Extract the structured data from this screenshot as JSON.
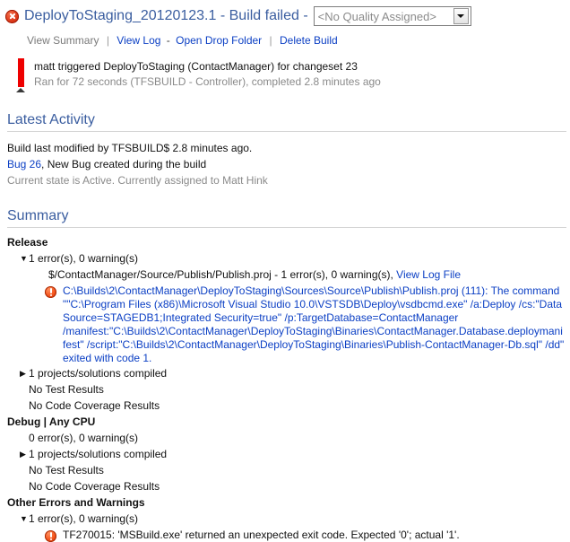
{
  "header": {
    "status_icon": "error-x-icon",
    "title": "DeployToStaging_20120123.1 - Build failed -",
    "quality": {
      "value": "<No Quality Assigned>",
      "dropdown_icon": "chevron-down-icon"
    }
  },
  "links": {
    "view_summary": "View Summary",
    "view_log": "View Log",
    "dash": "-",
    "open_drop_folder": "Open Drop Folder",
    "delete_build": "Delete Build",
    "separator": "|"
  },
  "trigger": {
    "line1": "matt triggered DeployToStaging (ContactManager) for changeset 23",
    "line2": "Ran for 72 seconds (TFSBUILD - Controller), completed 2.8 minutes ago"
  },
  "latest_activity": {
    "title": "Latest Activity",
    "modified": "Build last modified by TFSBUILD$ 2.8 minutes ago.",
    "bug_link": "Bug 26",
    "bug_rest": ", New Bug created during the build",
    "bug_state": "Current state is Active. Currently assigned to Matt Hink"
  },
  "summary": {
    "title": "Summary",
    "configurations": [
      {
        "name": "Release",
        "counts_row": {
          "twisty": "▼",
          "label": "1 error(s), 0 warning(s)"
        },
        "project_row": {
          "text": "$/ContactManager/Source/Publish/Publish.proj - 1 error(s), 0 warning(s), ",
          "link": "View Log File"
        },
        "errors": [
          {
            "icon": "error-exclamation-icon",
            "message": "C:\\Builds\\2\\ContactManager\\DeployToStaging\\Sources\\Source\\Publish\\Publish.proj (111): The command \"\"C:\\Program Files (x86)\\Microsoft Visual Studio 10.0\\VSTSDB\\Deploy\\vsdbcmd.exe\" /a:Deploy /cs:\"Data Source=STAGEDB1;Integrated Security=true\" /p:TargetDatabase=ContactManager /manifest:\"C:\\Builds\\2\\ContactManager\\DeployToStaging\\Binaries\\ContactManager.Database.deploymanifest\" /script:\"C:\\Builds\\2\\ContactManager\\DeployToStaging\\Binaries\\Publish-ContactManager-Db.sql\" /dd\" exited with code 1."
          }
        ],
        "compiled_row": {
          "twisty": "▶",
          "label": "1 projects/solutions compiled"
        },
        "test_results": "No Test Results",
        "coverage_results": "No Code Coverage Results"
      },
      {
        "name": "Debug | Any CPU",
        "counts_row": {
          "twisty": "",
          "label": "0 error(s), 0 warning(s)"
        },
        "compiled_row": {
          "twisty": "▶",
          "label": "1 projects/solutions compiled"
        },
        "test_results": "No Test Results",
        "coverage_results": "No Code Coverage Results"
      }
    ],
    "other_section": {
      "name": "Other Errors and Warnings",
      "counts_row": {
        "twisty": "▼",
        "label": "1 error(s), 0 warning(s)"
      },
      "errors": [
        {
          "icon": "error-exclamation-icon",
          "message": "TF270015: 'MSBuild.exe' returned an unexpected exit code. Expected '0'; actual '1'."
        }
      ]
    }
  },
  "colors": {
    "link": "#0b3fc4",
    "heading": "#3b5ea0",
    "error": "#df3b1b",
    "muted": "#8a8a8a",
    "rule": "#d4d4d4"
  }
}
